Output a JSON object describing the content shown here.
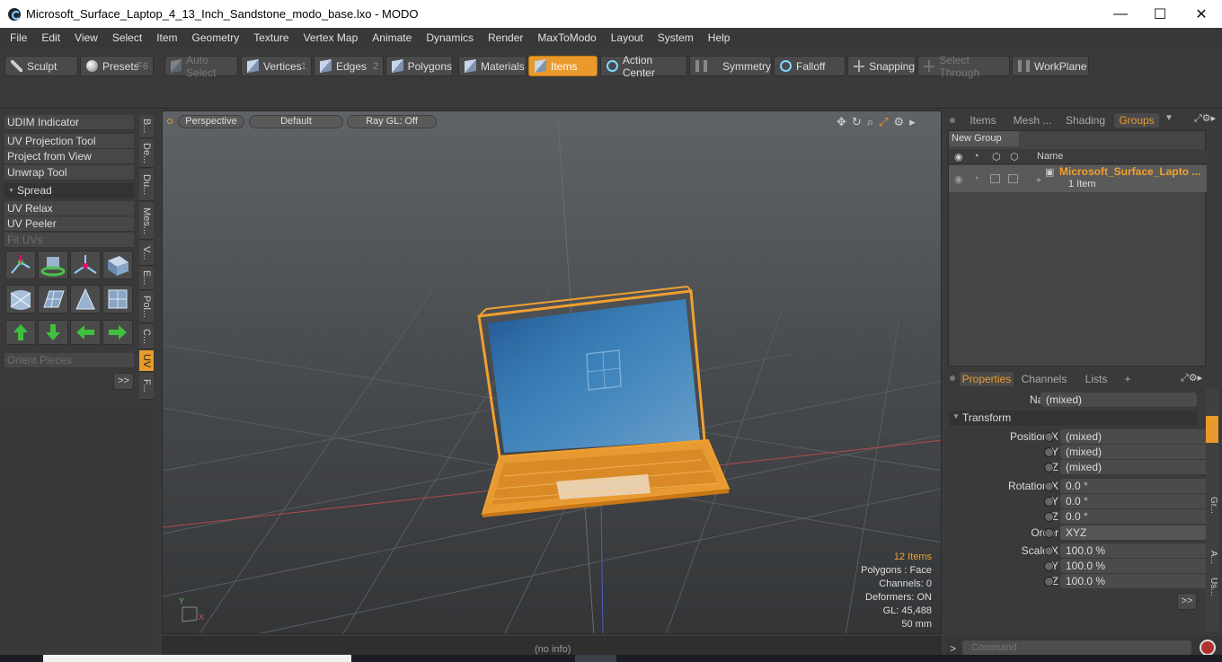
{
  "window": {
    "title": "Microsoft_Surface_Laptop_4_13_Inch_Sandstone_modo_base.lxo - MODO",
    "minimize": "—",
    "maximize": "☐",
    "close": "✕"
  },
  "menu": [
    "File",
    "Edit",
    "View",
    "Select",
    "Item",
    "Geometry",
    "Texture",
    "Vertex Map",
    "Animate",
    "Dynamics",
    "Render",
    "MaxToModo",
    "Layout",
    "System",
    "Help"
  ],
  "toolbar": {
    "sculpt": "Sculpt",
    "presets": "Presets",
    "presets_key": "F6",
    "auto_select": "Auto Select",
    "vertices": "Vertices",
    "vertices_num": "1",
    "edges": "Edges",
    "edges_num": "2",
    "polygons": "Polygons",
    "materials": "Materials",
    "items": "Items",
    "action_center": "Action Center",
    "symmetry": "Symmetry",
    "falloff": "Falloff",
    "snapping": "Snapping",
    "select_through": "Select Through",
    "workplane": "WorkPlane"
  },
  "left": {
    "udim": "UDIM Indicator",
    "uv_projection": "UV Projection Tool",
    "project_from_view": "Project from View",
    "unwrap": "Unwrap Tool",
    "spread": "Spread",
    "uv_relax": "UV Relax",
    "uv_peeler": "UV Peeler",
    "fit_uvs": "Fit UVs",
    "orient_pieces": "Orient Pieces",
    "more": ">>",
    "tabs": [
      "B...",
      "De...",
      "Du...",
      "Mes...",
      "V...",
      "E...",
      "Pol...",
      "C...",
      "UV",
      "F..."
    ]
  },
  "viewport": {
    "perspective": "Perspective",
    "default": "Default",
    "raygl": "Ray GL: Off",
    "items_count": "12 Items",
    "polygons": "Polygons : Face",
    "channels": "Channels: 0",
    "deformers": "Deformers: ON",
    "gl": "GL: 45,488",
    "scale": "50 mm",
    "axis_y": "Y",
    "axis_x": "X"
  },
  "status": {
    "info": "(no info)"
  },
  "groups": {
    "tabs": [
      "Items",
      "Mesh ...",
      "Shading",
      "Groups"
    ],
    "new_group": "New Group",
    "name_col": "Name",
    "item_name": "Microsoft_Surface_Lapto ...",
    "item_count": "1 Item"
  },
  "properties": {
    "tabs": [
      "Properties",
      "Channels",
      "Lists"
    ],
    "add": "+",
    "name_label": "Name",
    "name_value": "(mixed)",
    "transform": "Transform",
    "pos_label": "Position X",
    "y": "Y",
    "z": "Z",
    "pos_x": "(mixed)",
    "pos_y": "(mixed)",
    "pos_z": "(mixed)",
    "rot_label": "Rotation X",
    "rot_x": "0.0 °",
    "rot_y": "0.0 °",
    "rot_z": "0.0 °",
    "order_label": "Order",
    "order_value": "XYZ",
    "scale_label": "Scale X",
    "scale_x": "100.0 %",
    "scale_y": "100.0 %",
    "scale_z": "100.0 %",
    "more": ">>",
    "side_tabs": [
      "Gr...",
      "A...",
      "Us..."
    ]
  },
  "command": {
    "placeholder": "Command",
    "prompt": ">"
  },
  "colors": {
    "accent": "#e99a2b",
    "selection": "#f0a030"
  }
}
